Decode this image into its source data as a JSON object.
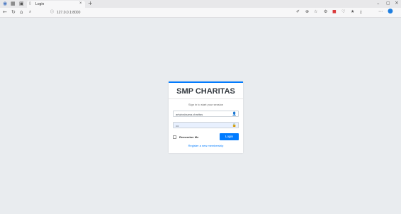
{
  "browser": {
    "tab_title": "Login",
    "url": "127.0.0.1:8000",
    "accent_color": "#007bff",
    "icons": [
      "app-icon",
      "workspaces-icon",
      "tab-actions-icon",
      "page-icon",
      "close-tab-icon",
      "new-tab-icon",
      "minimize-icon",
      "restore-icon",
      "close-window-icon",
      "back-icon",
      "refresh-icon",
      "home-icon",
      "search-icon",
      "info-icon",
      "read-aloud-icon",
      "zoom-icon",
      "favorite-icon",
      "extension-icon",
      "collections-icon",
      "browser-essentials-icon",
      "favorites-bar-icon",
      "downloads-icon",
      "settings-icon",
      "copilot-icon"
    ]
  },
  "login": {
    "title": "SMP CHARITAS",
    "message": "Sign in to start your session",
    "username_value": "ariwicaksana.charitas",
    "password_value": "•••",
    "remember_label": "Remember Me",
    "login_button": "Login",
    "register_link": "Register a new membership"
  }
}
